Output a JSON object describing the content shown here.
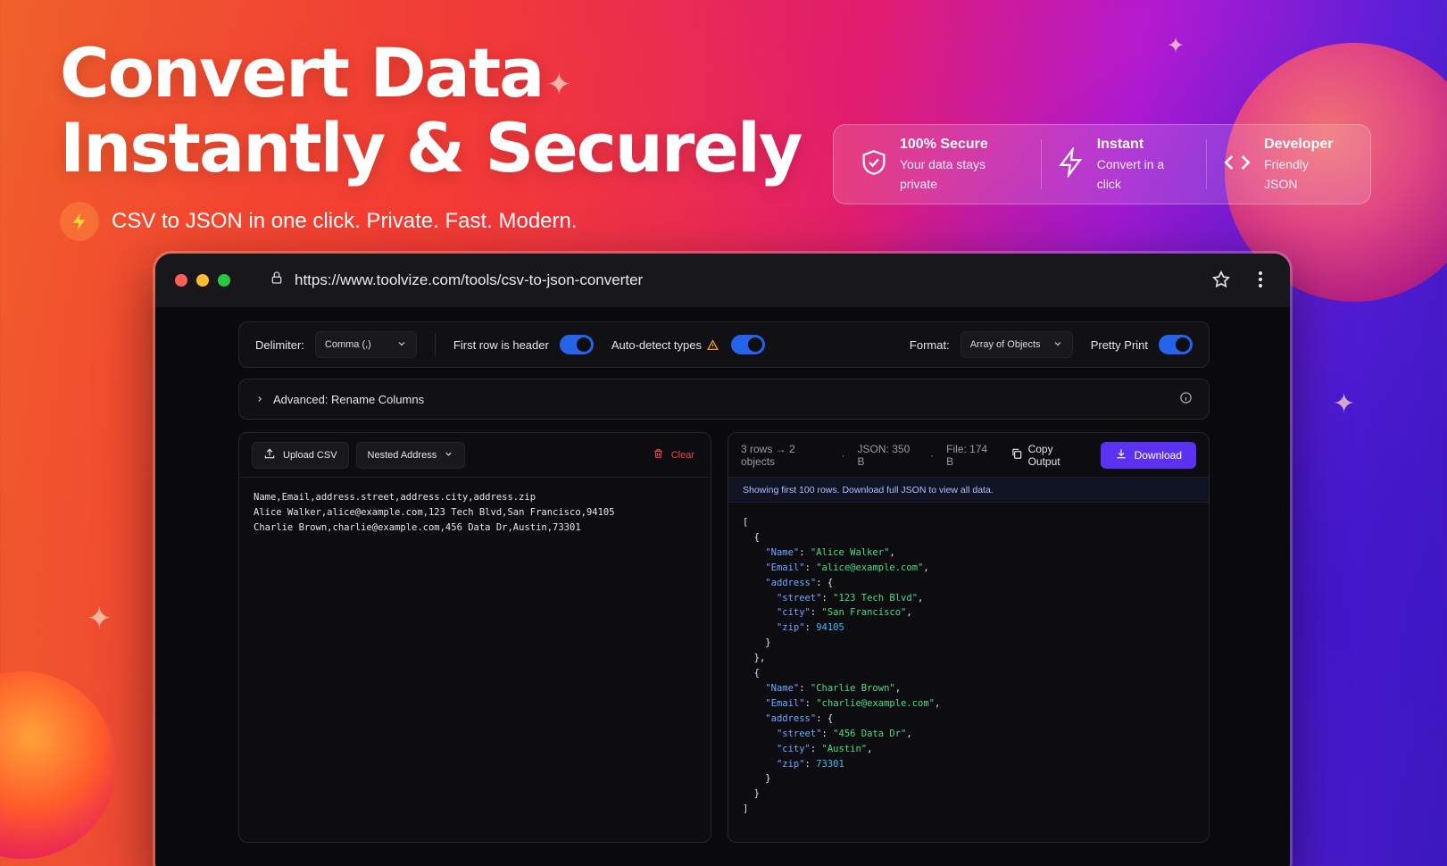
{
  "hero": {
    "title_line1": "Convert Data",
    "title_line2": "Instantly & Securely",
    "subtitle": "CSV to JSON in one click. Private. Fast. Modern."
  },
  "features": [
    {
      "icon": "shield-icon",
      "title": "100% Secure",
      "subtitle": "Your data stays private"
    },
    {
      "icon": "bolt-icon",
      "title": "Instant",
      "subtitle": "Convert in a click"
    },
    {
      "icon": "code-icon",
      "title": "Developer",
      "subtitle": "Friendly JSON"
    }
  ],
  "browser": {
    "url": "https://www.toolvize.com/tools/csv-to-json-converter"
  },
  "toolbar": {
    "delimiter_label": "Delimiter:",
    "delimiter_value": "Comma (,)",
    "header_label": "First row is header",
    "autodetect_label": "Auto-detect types",
    "format_label": "Format:",
    "format_value": "Array of Objects",
    "pretty_label": "Pretty Print"
  },
  "advanced": {
    "label": "Advanced: Rename Columns"
  },
  "input_panel": {
    "upload_label": "Upload CSV",
    "sample_label": "Nested Address",
    "clear_label": "Clear",
    "csv_lines": [
      "Name,Email,address.street,address.city,address.zip",
      "Alice Walker,alice@example.com,123 Tech Blvd,San Francisco,94105",
      "Charlie Brown,charlie@example.com,456 Data Dr,Austin,73301"
    ]
  },
  "output_panel": {
    "rows_stat": "3 rows → 2 objects",
    "json_size": "JSON: 350 B",
    "file_size": "File: 174 B",
    "copy_label": "Copy Output",
    "download_label": "Download",
    "notice": "Showing first 100 rows. Download full JSON to view all data.",
    "records": [
      {
        "Name": "Alice Walker",
        "Email": "alice@example.com",
        "street": "123 Tech Blvd",
        "city": "San Francisco",
        "zip": "94105"
      },
      {
        "Name": "Charlie Brown",
        "Email": "charlie@example.com",
        "street": "456 Data Dr",
        "city": "Austin",
        "zip": "73301"
      }
    ]
  },
  "colors": {
    "accent_blue": "#2563eb",
    "download_purple": "#5b32f2",
    "clear_red": "#ef4444",
    "json_string": "#4ade80",
    "json_key": "#6ea8ff"
  }
}
